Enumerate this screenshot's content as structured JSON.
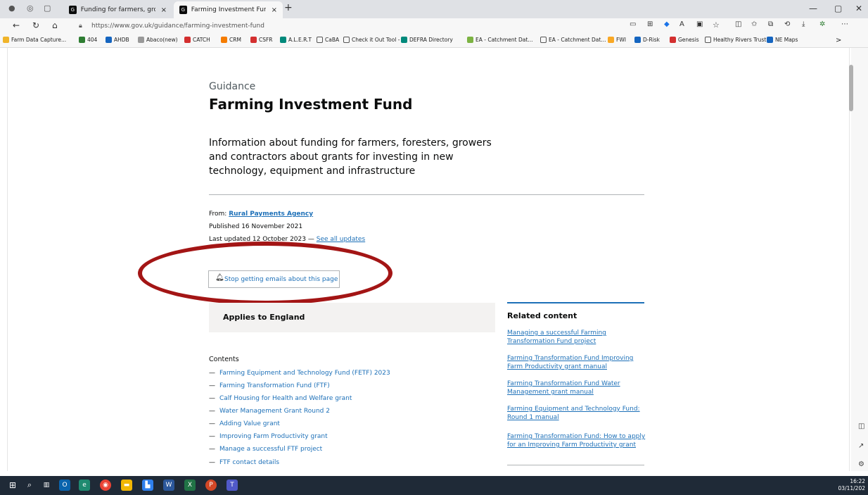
{
  "browser": {
    "tabs": [
      {
        "label": "Funding for farmers, growers and",
        "close": "×"
      },
      {
        "label": "Farming Investment Fund - GOV.",
        "close": "×"
      }
    ],
    "new_tab": "+",
    "url": "https://www.gov.uk/guidance/farming-investment-fund",
    "window_controls": {
      "minimize": "—",
      "restore": "▢",
      "close": "✕"
    },
    "bookmarks": [
      "Farm Data Capture...",
      "404",
      "AHDB",
      "Abaco(new)",
      "CATCH",
      "CRM",
      "CSFR",
      "A.L.E.R.T",
      "CaBA",
      "Check it Out Tool -",
      "DEFRA Directory",
      "EA - Catchment Dat...",
      "EA - Catchment Dat...",
      "FWI",
      "D-Risk",
      "Genesis",
      "Healthy Rivers Trust",
      "NE Maps"
    ],
    "more_bookmarks": ">"
  },
  "page": {
    "caption": "Guidance",
    "title": "Farming Investment Fund",
    "lead": "Information about funding for farmers, foresters, growers and contractors about grants for investing in new technology, equipment and infrastructure",
    "from_label": "From:",
    "from_org": "Rural Payments Agency",
    "published": "Published 16 November 2021",
    "last_updated": "Last updated 12 October 2023 —",
    "see_all_updates": "See all updates",
    "email_button": "Stop getting emails about this page",
    "applies": "Applies to England",
    "contents_title": "Contents",
    "contents": [
      "Farming Equipment and Technology Fund (FETF) 2023",
      "Farming Transformation Fund (FTF)",
      "Calf Housing for Health and Welfare grant",
      "Water Management Grant Round 2",
      "Adding Value grant",
      "Improving Farm Productivity grant",
      "Manage a successful FTF project",
      "FTF contact details"
    ],
    "related_title": "Related content",
    "related": [
      "Managing a successful Farming Transformation Fund project",
      "Farming Transformation Fund Improving Farm Productivity grant manual",
      "Farming Transformation Fund Water Management grant manual",
      "Farming Equipment and Technology Fund: Round 1 manual",
      "Farming Transformation Fund: How to apply for an Improving Farm Productivity grant"
    ]
  },
  "taskbar": {
    "time": "16:22",
    "date": "03/11/202"
  }
}
